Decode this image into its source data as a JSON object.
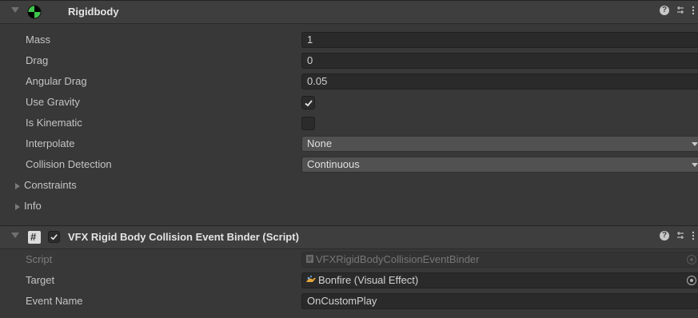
{
  "rigidbody": {
    "title": "Rigidbody",
    "properties": [
      {
        "label": "Mass",
        "value": "1"
      },
      {
        "label": "Drag",
        "value": "0"
      },
      {
        "label": "Angular Drag",
        "value": "0.05"
      }
    ],
    "use_gravity_label": "Use Gravity",
    "use_gravity_checked": true,
    "is_kinematic_label": "Is Kinematic",
    "is_kinematic_checked": false,
    "interpolate_label": "Interpolate",
    "interpolate_value": "None",
    "collision_detection_label": "Collision Detection",
    "collision_detection_value": "Continuous",
    "constraints_label": "Constraints",
    "info_label": "Info"
  },
  "binder": {
    "title": "VFX Rigid Body Collision Event Binder (Script)",
    "enabled": true,
    "script_label": "Script",
    "script_value": "VFXRigidBodyCollisionEventBinder",
    "target_label": "Target",
    "target_value": "Bonfire (Visual Effect)",
    "event_name_label": "Event Name",
    "event_name_value": "OnCustomPlay"
  },
  "colors": {
    "background": "#383838",
    "header": "#3e3e3e",
    "field": "#2a2a2a",
    "dropdown": "#515151",
    "rigidbody_icon_green": "#3ec54a"
  },
  "icons": [
    "foldout-arrow",
    "rigidbody-icon",
    "help-icon",
    "preset-icon",
    "more-options-icon",
    "script-icon",
    "checkbox-check",
    "object-picker-icon",
    "visual-effect-icon",
    "script-file-icon"
  ]
}
